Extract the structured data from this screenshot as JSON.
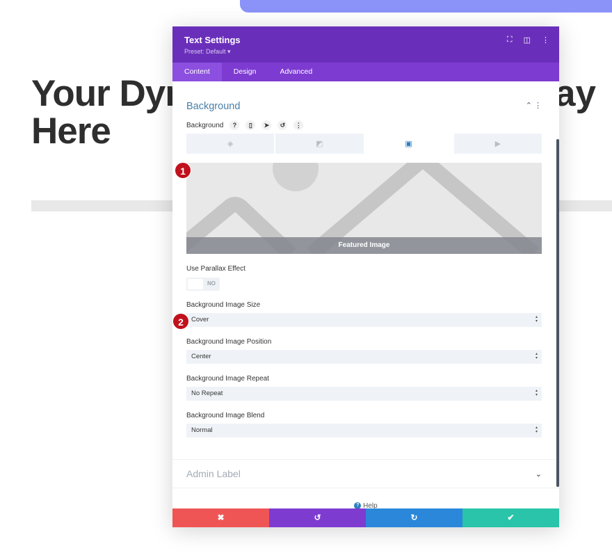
{
  "page": {
    "hero_left": "Your Dyn",
    "hero_right": "ay",
    "hero_line2": "Here"
  },
  "modal": {
    "title": "Text Settings",
    "preset": "Preset: Default ▾",
    "tabs": [
      {
        "label": "Content"
      },
      {
        "label": "Design"
      },
      {
        "label": "Advanced"
      }
    ],
    "section_title": "Background",
    "bg_label": "Background",
    "preview_caption": "Featured Image",
    "parallax_label": "Use Parallax Effect",
    "parallax_value": "NO",
    "fields": [
      {
        "label": "Background Image Size",
        "value": "Cover"
      },
      {
        "label": "Background Image Position",
        "value": "Center"
      },
      {
        "label": "Background Image Repeat",
        "value": "No Repeat"
      },
      {
        "label": "Background Image Blend",
        "value": "Normal"
      }
    ],
    "admin_label": "Admin Label",
    "help": "Help"
  },
  "badges": [
    "1",
    "2"
  ],
  "colors": {
    "header": "#6a2fba",
    "tabs": "#7d3bd1",
    "cancel": "#ef5555",
    "undo": "#7e3bd0",
    "redo": "#2b87da",
    "save": "#29c4a9"
  }
}
